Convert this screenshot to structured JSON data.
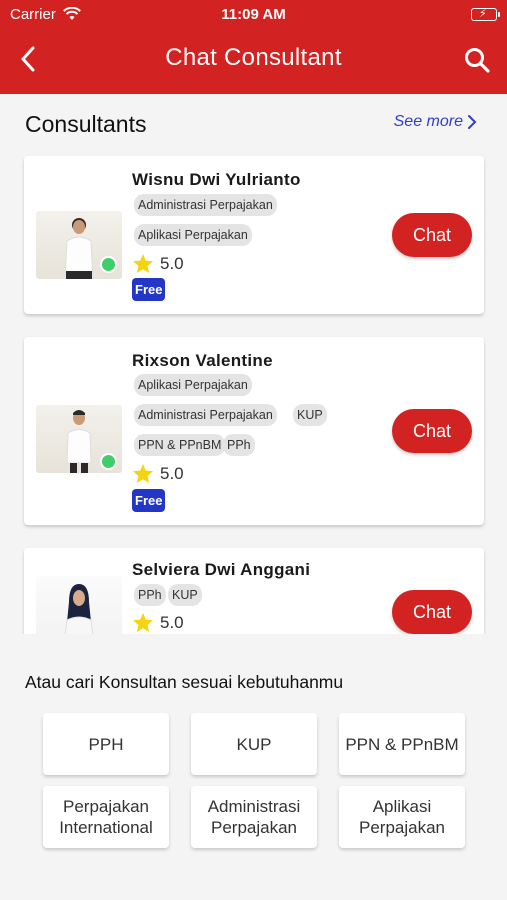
{
  "status_bar": {
    "carrier": "Carrier",
    "time": "11:09 AM"
  },
  "header": {
    "title": "Chat Consultant",
    "back_icon": "chevron-left-icon",
    "search_icon": "search-icon"
  },
  "consultants_section": {
    "title": "Consultants",
    "see_more": "See more"
  },
  "consultants": [
    {
      "name": "Wisnu Dwi Yulrianto",
      "tags": [
        "Administrasi Perpajakan",
        "Aplikasi Perpajakan"
      ],
      "rating": "5.0",
      "badge": "Free",
      "online": true,
      "chat_label": "Chat"
    },
    {
      "name": "Rixson Valentine",
      "tags": [
        "Aplikasi Perpajakan",
        "Administrasi Perpajakan",
        "KUP",
        "PPN & PPnBM",
        "PPh"
      ],
      "rating": "5.0",
      "badge": "Free",
      "online": true,
      "chat_label": "Chat"
    },
    {
      "name": "Selviera Dwi Anggani",
      "tags": [
        "PPh",
        "KUP"
      ],
      "rating": "5.0",
      "chat_label": "Chat"
    }
  ],
  "categories_section": {
    "title": "Atau cari Konsultan sesuai kebutuhanmu"
  },
  "categories": [
    "PPH",
    "KUP",
    "PPN & PPnBM",
    "Perpajakan\nInternational",
    "Administrasi\nPerpajakan",
    "Aplikasi\nPerpajakan"
  ],
  "colors": {
    "primary_red": "#d32222",
    "badge_blue": "#2436c8",
    "online_green": "#3fcf6a",
    "link_blue": "#2f3fc9"
  }
}
